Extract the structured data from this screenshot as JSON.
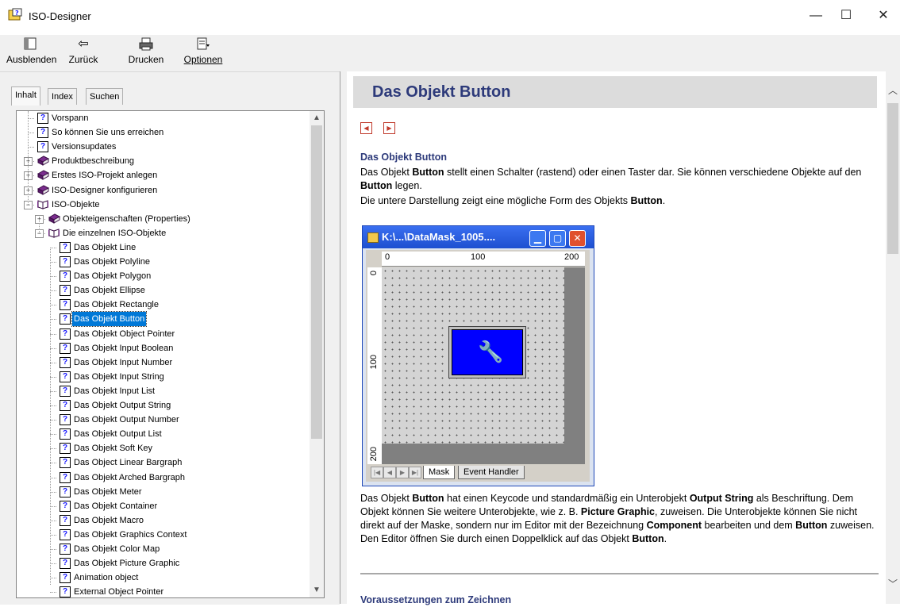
{
  "window": {
    "title": "ISO-Designer",
    "minimize": "—",
    "maximize": "☐",
    "close": "✕"
  },
  "toolbar": {
    "hide": "Ausblenden",
    "back": "Zurück",
    "print": "Drucken",
    "options": "Optionen"
  },
  "tabs": [
    "Inhalt",
    "Index",
    "Suchen"
  ],
  "tree": [
    {
      "label": "Vorspann",
      "icon": "help-page-icon",
      "level": 0,
      "expander": ""
    },
    {
      "label": "So können Sie uns erreichen",
      "icon": "help-page-icon",
      "level": 0,
      "expander": ""
    },
    {
      "label": "Versionsupdates",
      "icon": "help-page-icon",
      "level": 0,
      "expander": ""
    },
    {
      "label": "Produktbeschreibung",
      "icon": "closed-book-icon",
      "level": 0,
      "expander": "+"
    },
    {
      "label": "Erstes ISO-Projekt anlegen",
      "icon": "closed-book-icon",
      "level": 0,
      "expander": "+"
    },
    {
      "label": "ISO-Designer konfigurieren",
      "icon": "closed-book-icon",
      "level": 0,
      "expander": "+"
    },
    {
      "label": "ISO-Objekte",
      "icon": "open-book-icon",
      "level": 0,
      "expander": "−"
    },
    {
      "label": "Objekteigenschaften (Properties)",
      "icon": "closed-book-icon",
      "level": 1,
      "expander": "+"
    },
    {
      "label": "Die einzelnen ISO-Objekte",
      "icon": "open-book-icon",
      "level": 1,
      "expander": "−"
    },
    {
      "label": "Das Objekt Line",
      "icon": "help-page-icon",
      "level": 2,
      "expander": ""
    },
    {
      "label": "Das Objekt Polyline",
      "icon": "help-page-icon",
      "level": 2,
      "expander": ""
    },
    {
      "label": "Das Objekt Polygon",
      "icon": "help-page-icon",
      "level": 2,
      "expander": ""
    },
    {
      "label": "Das Objekt Ellipse",
      "icon": "help-page-icon",
      "level": 2,
      "expander": ""
    },
    {
      "label": "Das Objekt Rectangle",
      "icon": "help-page-icon",
      "level": 2,
      "expander": ""
    },
    {
      "label": "Das Objekt Button",
      "icon": "help-page-icon",
      "level": 2,
      "expander": "",
      "selected": true
    },
    {
      "label": "Das Objekt Object Pointer",
      "icon": "help-page-icon",
      "level": 2,
      "expander": ""
    },
    {
      "label": "Das Objekt Input Boolean",
      "icon": "help-page-icon",
      "level": 2,
      "expander": ""
    },
    {
      "label": "Das Objekt Input Number",
      "icon": "help-page-icon",
      "level": 2,
      "expander": ""
    },
    {
      "label": "Das Objekt Input String",
      "icon": "help-page-icon",
      "level": 2,
      "expander": ""
    },
    {
      "label": "Das Objekt Input List",
      "icon": "help-page-icon",
      "level": 2,
      "expander": ""
    },
    {
      "label": "Das Objekt Output String",
      "icon": "help-page-icon",
      "level": 2,
      "expander": ""
    },
    {
      "label": "Das Objekt Output Number",
      "icon": "help-page-icon",
      "level": 2,
      "expander": ""
    },
    {
      "label": "Das Objekt Output List",
      "icon": "help-page-icon",
      "level": 2,
      "expander": ""
    },
    {
      "label": "Das Objekt Soft Key",
      "icon": "help-page-icon",
      "level": 2,
      "expander": ""
    },
    {
      "label": "Das Object Linear Bargraph",
      "icon": "help-page-icon",
      "level": 2,
      "expander": ""
    },
    {
      "label": "Das Objekt Arched Bargraph",
      "icon": "help-page-icon",
      "level": 2,
      "expander": ""
    },
    {
      "label": "Das Objekt Meter",
      "icon": "help-page-icon",
      "level": 2,
      "expander": ""
    },
    {
      "label": "Das Objekt Container",
      "icon": "help-page-icon",
      "level": 2,
      "expander": ""
    },
    {
      "label": "Das Objekt Macro",
      "icon": "help-page-icon",
      "level": 2,
      "expander": ""
    },
    {
      "label": "Das Objekt Graphics Context",
      "icon": "help-page-icon",
      "level": 2,
      "expander": ""
    },
    {
      "label": "Das Objekt Color Map",
      "icon": "help-page-icon",
      "level": 2,
      "expander": ""
    },
    {
      "label": "Das Objekt Picture Graphic",
      "icon": "help-page-icon",
      "level": 2,
      "expander": ""
    },
    {
      "label": "Animation object",
      "icon": "help-page-icon",
      "level": 2,
      "expander": ""
    },
    {
      "label": "External Object Pointer",
      "icon": "help-page-icon",
      "level": 2,
      "expander": ""
    }
  ],
  "article": {
    "heading": "Das Objekt Button",
    "section_title": "Das Objekt Button",
    "para1": [
      {
        "t": "Das Objekt "
      },
      {
        "t": "Button",
        "b": true
      },
      {
        "t": " stellt einen Schalter (rastend) oder einen Taster dar. Sie können verschiedene Objekte auf den "
      },
      {
        "t": "Button",
        "b": true
      },
      {
        "t": " legen."
      }
    ],
    "para2": [
      {
        "t": "Die untere Darstellung zeigt eine mögliche Form des Objekts "
      },
      {
        "t": "Button",
        "b": true
      },
      {
        "t": "."
      }
    ],
    "para3": [
      {
        "t": "Das Objekt "
      },
      {
        "t": "Button",
        "b": true
      },
      {
        "t": " hat einen Keycode und standardmäßig ein Unterobjekt "
      },
      {
        "t": "Output String",
        "b": true
      },
      {
        "t": " als Beschriftung. Dem Objekt können Sie weitere Unterobjekte, wie z. B. "
      },
      {
        "t": "Picture Graphic",
        "b": true
      },
      {
        "t": ", zuweisen. Die Unterobjekte können Sie nicht direkt auf der Maske, sondern nur im Editor mit der Bezeichnung "
      },
      {
        "t": "Component",
        "b": true
      },
      {
        "t": " bearbeiten und dem "
      },
      {
        "t": "Button",
        "b": true
      },
      {
        "t": " zuweisen. Den Editor öffnen Sie durch einen Doppelklick auf das Objekt "
      },
      {
        "t": "Button",
        "b": true
      },
      {
        "t": "."
      }
    ],
    "next_section_title": "Voraussetzungen zum Zeichnen"
  },
  "screenshot": {
    "title": "K:\\...\\DataMask_1005....",
    "ruler_h": [
      "0",
      "100",
      "200"
    ],
    "ruler_v": [
      "0",
      "100",
      "200"
    ],
    "sheet_tabs": [
      "Mask",
      "Event Handler"
    ]
  },
  "colors": {
    "heading": "#2d3a7a",
    "selection": "#0078d7",
    "mask_button": "#0000ff",
    "book": "#7b2d8e"
  }
}
